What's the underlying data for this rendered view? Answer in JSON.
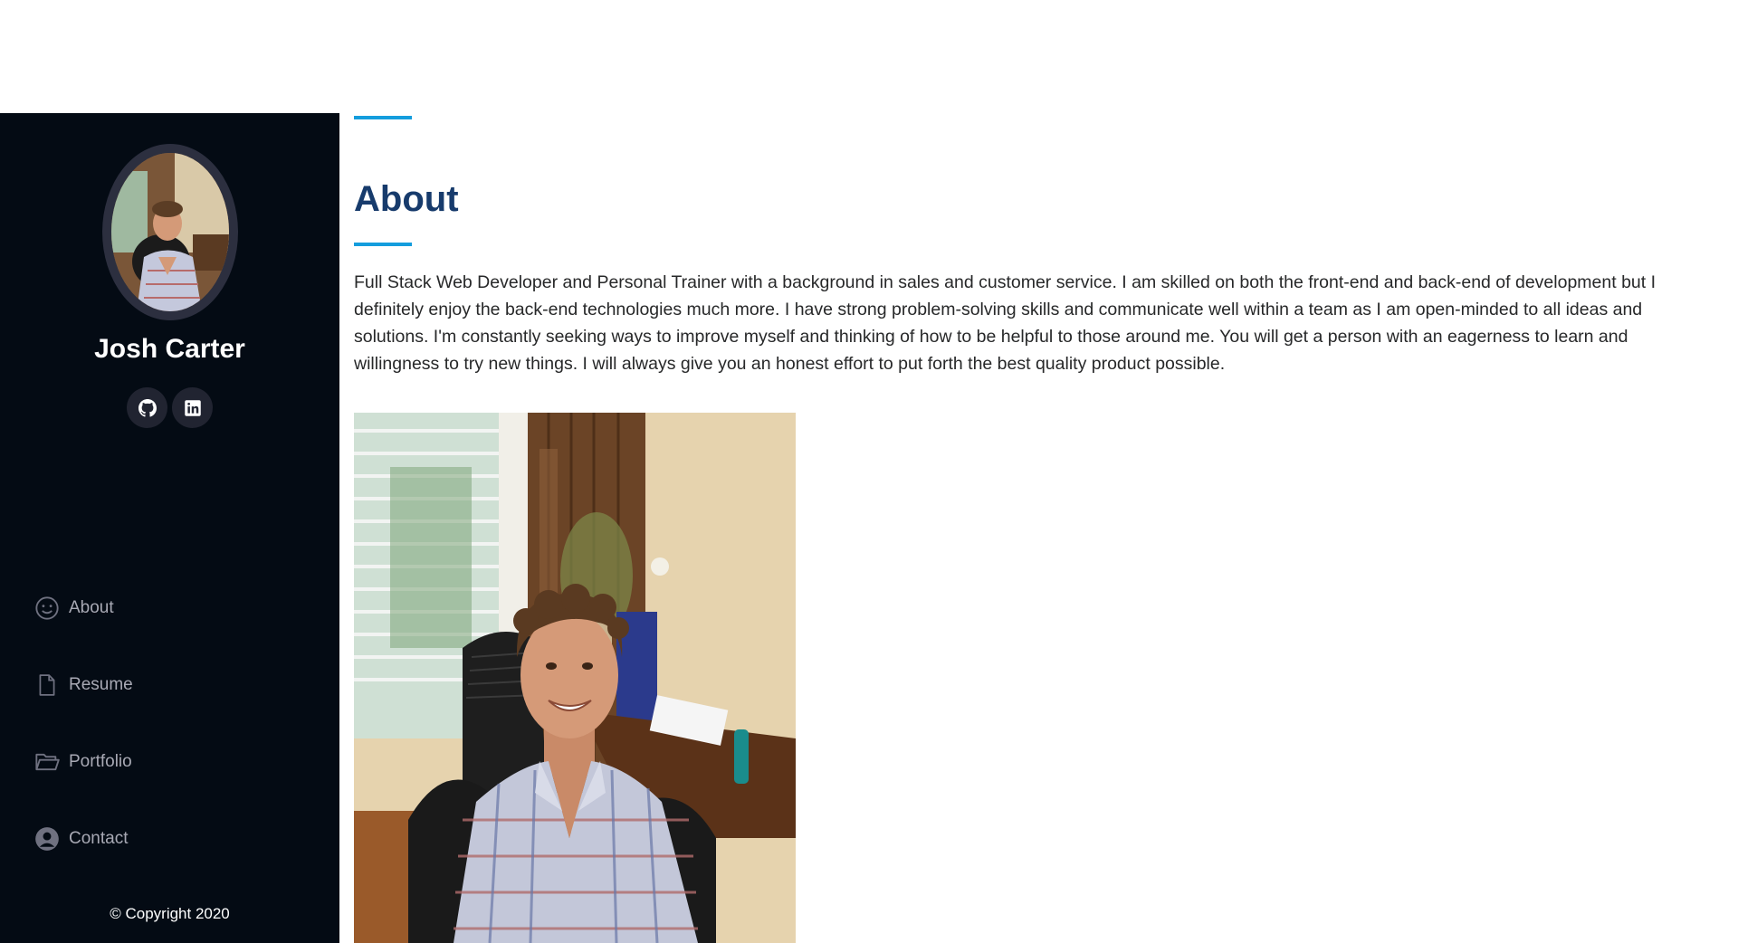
{
  "profile": {
    "name": "Josh Carter",
    "social": [
      {
        "icon": "github-icon",
        "label": "GitHub"
      },
      {
        "icon": "linkedin-icon",
        "label": "LinkedIn"
      }
    ]
  },
  "nav": {
    "items": [
      {
        "label": "About",
        "icon": "smile-icon"
      },
      {
        "label": "Resume",
        "icon": "file-icon"
      },
      {
        "label": "Portfolio",
        "icon": "folder-icon"
      },
      {
        "label": "Contact",
        "icon": "user-circle-icon"
      }
    ]
  },
  "footer": {
    "copyright": "© Copyright 2020"
  },
  "about": {
    "title": "About",
    "body": "Full Stack Web Developer and Personal Trainer with a background in sales and customer service. I am skilled on both the front-end and back-end of development but I definitely enjoy the back-end technologies much more. I have strong problem-solving skills and communicate well within a team as I am open-minded to all ideas and solutions. I'm constantly seeking ways to improve myself and thinking of how to be helpful to those around me. You will get a person with an eagerness to learn and willingness to try new things. I will always give you an honest effort to put forth the best quality product possible."
  },
  "colors": {
    "sidebar_bg": "#040b14",
    "accent": "#149ddd",
    "title": "#173b6c",
    "nav_text": "#a8a9b4"
  }
}
